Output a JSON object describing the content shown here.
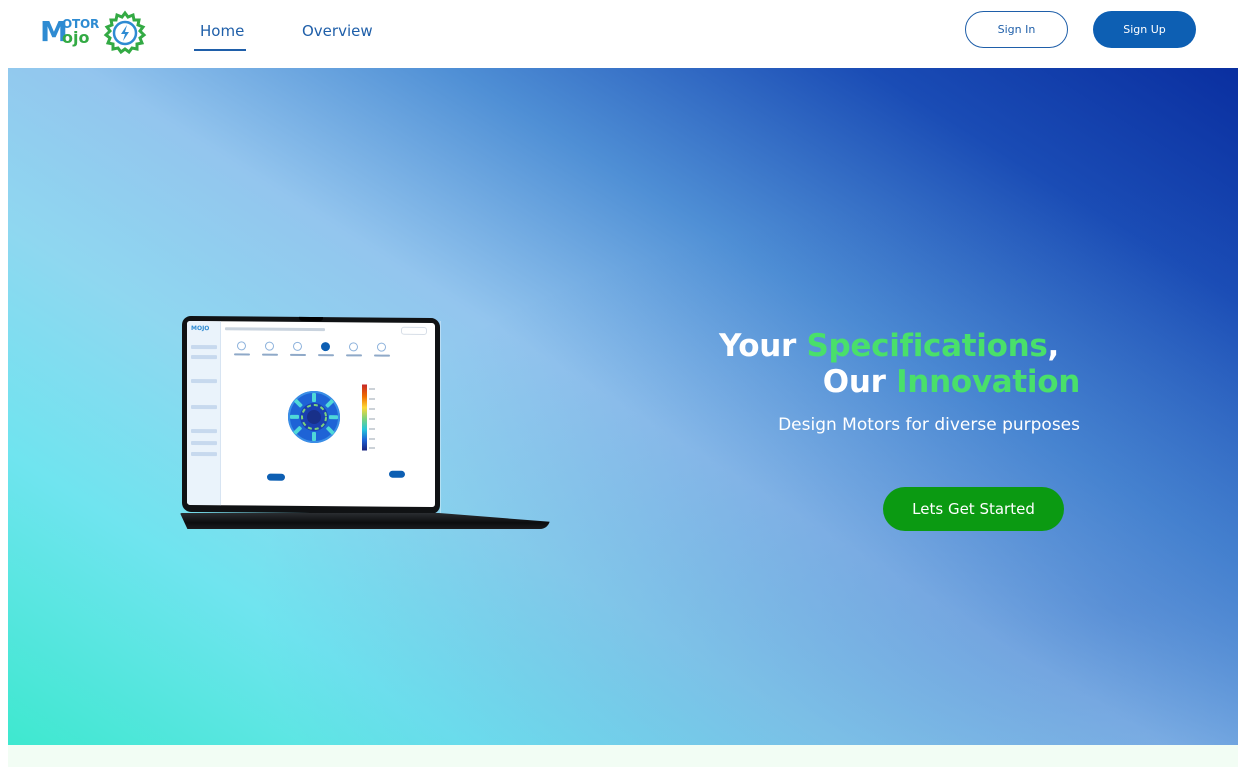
{
  "brand": {
    "logo_main": "M",
    "logo_top": "OTOR",
    "logo_bottom": "ojo",
    "primary_color": "#0d5fb3",
    "accent_green": "#49e06a"
  },
  "nav": {
    "links": [
      {
        "label": "Home",
        "active": true
      },
      {
        "label": "Overview",
        "active": false
      }
    ]
  },
  "auth": {
    "sign_in": "Sign In",
    "sign_up": "Sign Up"
  },
  "hero": {
    "title_line1_part1": "Your ",
    "title_line1_highlight": "Specifications",
    "title_line1_part2": ",",
    "title_line2_part1": "Our ",
    "title_line2_highlight": "Innovation",
    "subtitle": "Design Motors for diverse purposes",
    "cta_label": "Lets Get Started",
    "cta_color": "#0b9a12"
  },
  "laptop_preview": {
    "icon": "laptop-mockup",
    "mini_logo": "MOJO"
  }
}
